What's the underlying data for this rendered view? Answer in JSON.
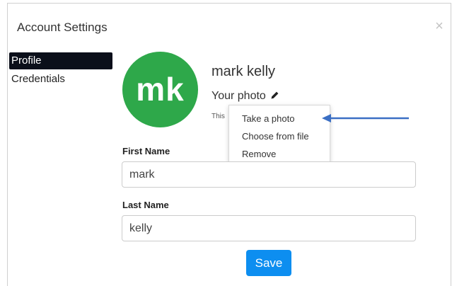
{
  "dialog": {
    "title": "Account Settings",
    "close_glyph": "×"
  },
  "sidebar": {
    "items": [
      {
        "label": "Profile",
        "active": true
      },
      {
        "label": "Credentials",
        "active": false
      }
    ]
  },
  "profile": {
    "avatar_initials": "mk",
    "avatar_color": "#2ea84a",
    "name": "mark kelly",
    "photo_label": "Your photo",
    "photo_icon": "pencil-icon",
    "hint": "This"
  },
  "photo_menu": {
    "items": [
      {
        "label": "Take a photo"
      },
      {
        "label": "Choose from file"
      },
      {
        "label": "Remove"
      }
    ]
  },
  "form": {
    "first_name_label": "First Name",
    "first_name_value": "mark",
    "last_name_label": "Last Name",
    "last_name_value": "kelly",
    "save_label": "Save"
  },
  "colors": {
    "accent": "#0d8ef0",
    "sidebar_active_bg": "#0b0f1a",
    "annotation_arrow": "#3b6fc4"
  }
}
